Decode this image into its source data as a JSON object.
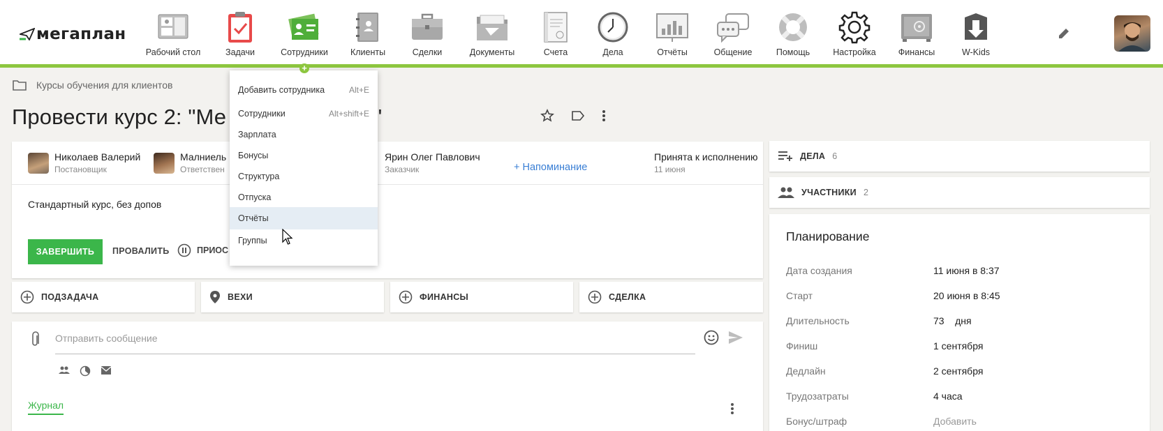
{
  "app": {
    "logo_text": "мегаплан"
  },
  "nav": {
    "items": [
      {
        "label": "Рабочий стол",
        "icon": "desktop-icon"
      },
      {
        "label": "Задачи",
        "icon": "tasks-clipboard-icon"
      },
      {
        "label": "Сотрудники",
        "icon": "employees-card-icon"
      },
      {
        "label": "Клиенты",
        "icon": "clients-book-icon"
      },
      {
        "label": "Сделки",
        "icon": "deals-briefcase-icon"
      },
      {
        "label": "Документы",
        "icon": "documents-folder-icon"
      },
      {
        "label": "Счета",
        "icon": "invoice-icon"
      },
      {
        "label": "Дела",
        "icon": "clock-icon"
      },
      {
        "label": "Отчёты",
        "icon": "reports-chart-icon"
      },
      {
        "label": "Общение",
        "icon": "chat-bubbles-icon"
      },
      {
        "label": "Помощь",
        "icon": "lifebuoy-icon"
      },
      {
        "label": "Настройка",
        "icon": "gear-icon"
      },
      {
        "label": "Финансы",
        "icon": "safe-icon"
      },
      {
        "label": "W-Kids",
        "icon": "w-kids-download-icon"
      }
    ],
    "active_accent": "#8dc63f"
  },
  "breadcrumb": {
    "text": "Курсы обучения для клиентов"
  },
  "task": {
    "title": "Провести курс 2: \"Ме                              министратора\"",
    "people": [
      {
        "name": "Николаев Валерий",
        "role": "Постановщик"
      },
      {
        "name": "Малниель",
        "role": "Ответствен"
      },
      {
        "name": "Ярин Олег Павлович",
        "role": "Заказчик"
      }
    ],
    "reminder": "+ Напоминание",
    "status": "Принята к исполнению",
    "status_date": "11 июня",
    "description": "Стандартный курс, без допов",
    "buttons": {
      "complete": "ЗАВЕРШИТЬ",
      "fail": "ПРОВАЛИТЬ",
      "pause": "ПРИОС"
    }
  },
  "tiles": [
    {
      "label": "ПОДЗАДАЧА",
      "icon": "plus-circle-icon"
    },
    {
      "label": "ВЕХИ",
      "icon": "map-pin-icon"
    },
    {
      "label": "ФИНАНСЫ",
      "icon": "plus-circle-icon"
    },
    {
      "label": "СДЕЛКА",
      "icon": "plus-circle-icon"
    }
  ],
  "message": {
    "placeholder": "Отправить сообщение",
    "journal_tab": "Журнал"
  },
  "side": {
    "deals_label": "ДЕЛА",
    "deals_count": "6",
    "participants_label": "УЧАСТНИКИ",
    "participants_count": "2"
  },
  "planning": {
    "title": "Планирование",
    "rows": [
      {
        "key": "Дата создания",
        "value": "11 июня в 8:37"
      },
      {
        "key": "Старт",
        "value": "20 июня в 8:45"
      },
      {
        "key": "Длительность",
        "value": "73    дня"
      },
      {
        "key": "Финиш",
        "value": "1 сентября"
      },
      {
        "key": "Дедлайн",
        "value": "2 сентября"
      },
      {
        "key": "Трудозатраты",
        "value": "4 часа"
      },
      {
        "key": "Бонус/штраф",
        "value": "Добавить"
      }
    ]
  },
  "dropdown": {
    "items": [
      {
        "label": "Добавить сотрудника",
        "shortcut": "Alt+E"
      },
      {
        "label": "Сотрудники",
        "shortcut": "Alt+shift+E"
      },
      {
        "label": "Зарплата",
        "shortcut": ""
      },
      {
        "label": "Бонусы",
        "shortcut": ""
      },
      {
        "label": "Структура",
        "shortcut": ""
      },
      {
        "label": "Отпуска",
        "shortcut": ""
      },
      {
        "label": "Отчёты",
        "shortcut": ""
      },
      {
        "label": "Группы",
        "shortcut": ""
      }
    ],
    "highlighted": "Отчёты"
  }
}
